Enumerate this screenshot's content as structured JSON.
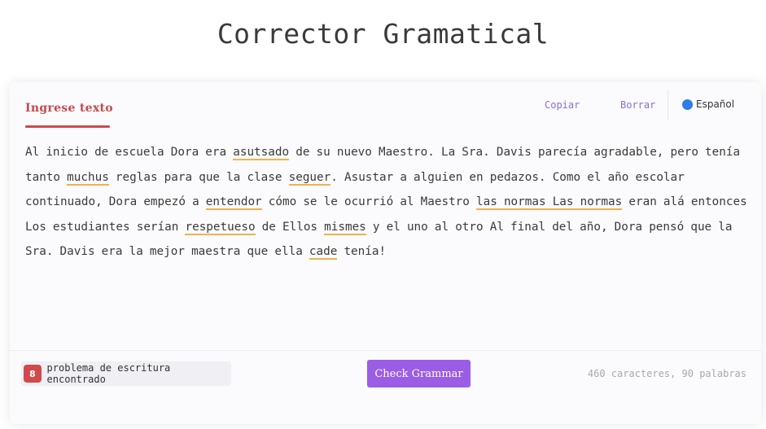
{
  "header": {
    "title": "Corrector Gramatical"
  },
  "editor": {
    "tab_label": "Ingrese texto",
    "copy_label": "Copiar",
    "clear_label": "Borrar",
    "language": "Español",
    "colors": {
      "accent": "#d04a4c",
      "link": "#8b6fd6",
      "underline": "#f2b04e",
      "language_dot": "#2b7de9"
    },
    "segments": [
      {
        "text": "Al inicio de escuela Dora era ",
        "error": false
      },
      {
        "text": "asutsado",
        "error": true
      },
      {
        "text": " de su nuevo Maestro. La Sra. Davis parecía agradable, pero tenía tanto ",
        "error": false
      },
      {
        "text": "muchus",
        "error": true
      },
      {
        "text": " reglas para que la clase ",
        "error": false
      },
      {
        "text": "seguer",
        "error": true
      },
      {
        "text": ". Asustar a alguien en pedazos. Como el año escolar continuado, Dora empezó a ",
        "error": false
      },
      {
        "text": "entendor",
        "error": true
      },
      {
        "text": " cómo se le ocurrió al Maestro ",
        "error": false
      },
      {
        "text": "las normas Las normas",
        "error": true
      },
      {
        "text": " eran alá entonces Los estudiantes serían ",
        "error": false
      },
      {
        "text": "respetueso",
        "error": true
      },
      {
        "text": " de Ellos ",
        "error": false
      },
      {
        "text": "mismes",
        "error": true
      },
      {
        "text": " y el uno al otro Al final del año, Dora pensó que la Sra. Davis era la mejor maestra que ella ",
        "error": false
      },
      {
        "text": "cade",
        "error": true
      },
      {
        "text": " tenía!",
        "error": false
      }
    ]
  },
  "footer": {
    "issue_count": "8",
    "issue_label": "problema de escritura encontrado",
    "check_button": "Check Grammar",
    "stats": "460 caracteres, 90 palabras",
    "colors": {
      "button": "#9b5de5",
      "badge": "#d04a4c"
    }
  }
}
